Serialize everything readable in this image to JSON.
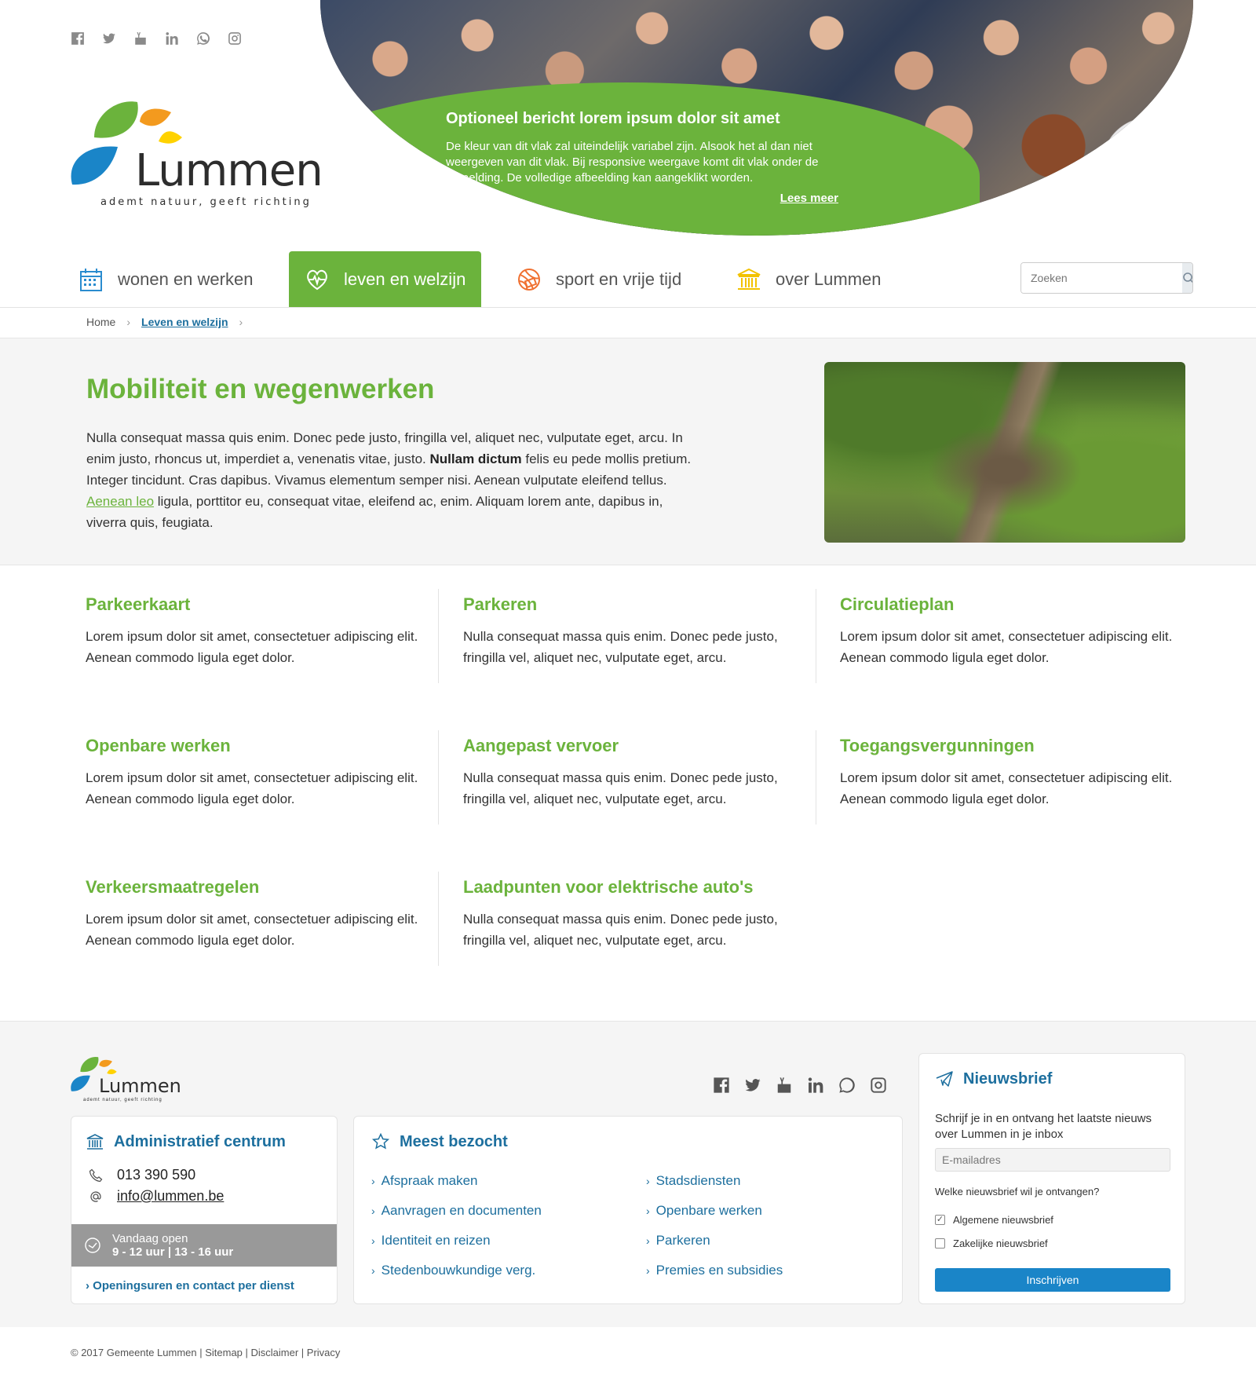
{
  "social": [
    "facebook-icon",
    "twitter-icon",
    "youtube-icon",
    "linkedin-icon",
    "whatsapp-icon",
    "instagram-icon"
  ],
  "logo": {
    "name": "Lummen",
    "tagline": "ademt natuur, geeft richting"
  },
  "hero": {
    "title": "Optioneel bericht lorem ipsum dolor sit amet",
    "text": "De kleur van dit vlak zal uiteindelijk variabel zijn. Alsook het al dan niet weergeven van dit vlak. Bij responsive weergave komt dit vlak onder de afbeelding. De volledige afbeelding kan aangeklikt worden.",
    "link": "Lees meer",
    "panel_color": "#6bb33c"
  },
  "nav": {
    "items": [
      {
        "label": "wonen en werken",
        "icon": "calendar-icon"
      },
      {
        "label": "leven en welzijn",
        "icon": "heart-pulse-icon",
        "active": true
      },
      {
        "label": "sport en vrije tijd",
        "icon": "ball-icon"
      },
      {
        "label": "over Lummen",
        "icon": "town-hall-icon"
      }
    ],
    "search_placeholder": "Zoeken"
  },
  "breadcrumb": {
    "home": "Home",
    "current": "Leven en welzijn"
  },
  "intro": {
    "title": "Mobiliteit en wegenwerken",
    "p1": "Nulla consequat massa quis enim. Donec pede justo, fringilla vel, aliquet nec, vulputate eget, arcu. In enim justo, rhoncus ut, imperdiet a, venenatis vitae, justo.",
    "bold": "Nullam dictum",
    "p2": "felis eu pede mollis pretium. Integer tincidunt. Cras dapibus. Vivamus elementum semper nisi. Aenean vulputate eleifend tellus.",
    "link": "Aenean leo",
    "p3": "ligula, porttitor eu, consequat vitae, eleifend ac, enim. Aliquam lorem ante, dapibus in, viverra quis, feugiata."
  },
  "cards": [
    {
      "title": "Parkeerkaart",
      "text": "Lorem ipsum dolor sit amet, consectetuer adipiscing elit. Aenean commodo ligula eget dolor."
    },
    {
      "title": "Parkeren",
      "text": "Nulla consequat massa quis enim. Donec pede justo, fringilla vel, aliquet nec, vulputate eget, arcu."
    },
    {
      "title": "Circulatieplan",
      "text": "Lorem ipsum dolor sit amet, consectetuer adipiscing elit. Aenean commodo ligula eget dolor."
    },
    {
      "title": "Openbare werken",
      "text": "Lorem ipsum dolor sit amet, consectetuer adipiscing elit. Aenean commodo ligula eget dolor."
    },
    {
      "title": "Aangepast vervoer",
      "text": "Nulla consequat massa quis enim. Donec pede justo, fringilla vel, aliquet nec, vulputate eget, arcu."
    },
    {
      "title": "Toegangsvergunningen",
      "text": "Lorem ipsum dolor sit amet, consectetuer adipiscing elit. Aenean commodo ligula eget dolor."
    },
    {
      "title": "Verkeersmaatregelen",
      "text": "Lorem ipsum dolor sit amet, consectetuer adipiscing elit. Aenean commodo ligula eget dolor."
    },
    {
      "title": "Laadpunten voor elektrische auto's",
      "text": "Nulla consequat massa quis enim. Donec pede justo, fringilla vel, aliquet nec, vulputate eget, arcu."
    }
  ],
  "footer": {
    "admin": {
      "title": "Administratief centrum",
      "phone": "013 390 590",
      "email": "info@lummen.be",
      "open_label": "Vandaag open",
      "open_hours": "9 - 12 uur | 13 - 16 uur",
      "more": "Openingsuren en contact per dienst"
    },
    "meest": {
      "title": "Meest bezocht",
      "links": [
        "Afspraak maken",
        "Stadsdiensten",
        "Aanvragen en documenten",
        "Openbare werken",
        "Identiteit en reizen",
        "Parkeren",
        "Stedenbouwkundige verg.",
        "Premies en subsidies"
      ]
    },
    "news": {
      "title": "Nieuwsbrief",
      "desc": "Schrijf je in en ontvang het laatste nieuws over Lummen in je inbox",
      "email_placeholder": "E-mailadres",
      "question": "Welke nieuwsbrief wil je ontvangen?",
      "opt1": "Algemene nieuwsbrief",
      "opt1_checked": true,
      "opt2": "Zakelijke nieuwsbrief",
      "opt2_checked": false,
      "button": "Inschrijven"
    },
    "copyright": "© 2017 Gemeente Lummen | Sitemap | Disclaimer | Privacy"
  },
  "colors": {
    "green": "#6bb33c",
    "blue": "#1d6f9e",
    "button": "#1a85c8"
  }
}
